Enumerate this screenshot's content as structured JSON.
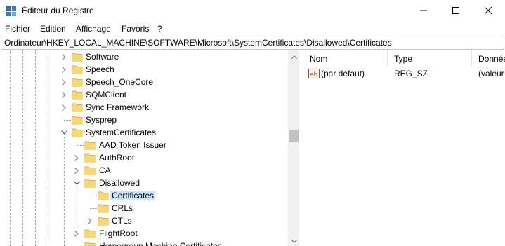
{
  "window": {
    "title": "Éditeur du Registre",
    "icon": "regedit-icon",
    "controls": [
      "minimize-icon",
      "maximize-icon",
      "close-icon"
    ]
  },
  "menu": {
    "items": [
      "Fichier",
      "Edition",
      "Affichage",
      "Favoris",
      "?"
    ]
  },
  "address": {
    "path": "Ordinateur\\HKEY_LOCAL_MACHINE\\SOFTWARE\\Microsoft\\SystemCertificates\\Disallowed\\Certificates"
  },
  "tree": {
    "items": [
      {
        "label": "Software",
        "level": 0,
        "chevron": "collapsed",
        "selected": false
      },
      {
        "label": "Speech",
        "level": 0,
        "chevron": "collapsed",
        "selected": false
      },
      {
        "label": "Speech_OneCore",
        "level": 0,
        "chevron": "collapsed",
        "selected": false
      },
      {
        "label": "SQMClient",
        "level": 0,
        "chevron": "collapsed",
        "selected": false
      },
      {
        "label": "Sync Framework",
        "level": 0,
        "chevron": "collapsed",
        "selected": false
      },
      {
        "label": "Sysprep",
        "level": 0,
        "chevron": "none",
        "selected": false
      },
      {
        "label": "SystemCertificates",
        "level": 0,
        "chevron": "expanded",
        "selected": false
      },
      {
        "label": "AAD Token Issuer",
        "level": 1,
        "chevron": "none",
        "selected": false
      },
      {
        "label": "AuthRoot",
        "level": 1,
        "chevron": "collapsed",
        "selected": false
      },
      {
        "label": "CA",
        "level": 1,
        "chevron": "collapsed",
        "selected": false
      },
      {
        "label": "Disallowed",
        "level": 1,
        "chevron": "expanded",
        "selected": false
      },
      {
        "label": "Certificates",
        "level": 2,
        "chevron": "none",
        "selected": true
      },
      {
        "label": "CRLs",
        "level": 2,
        "chevron": "none",
        "selected": false
      },
      {
        "label": "CTLs",
        "level": 2,
        "chevron": "collapsed",
        "selected": false
      },
      {
        "label": "FlightRoot",
        "level": 1,
        "chevron": "collapsed",
        "selected": false
      },
      {
        "label": "Homegroup Machine Certificates",
        "level": 1,
        "chevron": "none",
        "selected": false
      }
    ]
  },
  "values": {
    "columns": [
      "Nom",
      "Type",
      "Données"
    ],
    "rows": [
      {
        "icon": "string-value-icon",
        "name": "(par défaut)",
        "type": "REG_SZ",
        "data": "(valeur non définie)"
      }
    ]
  },
  "colors": {
    "selection": "#cce8ff",
    "folder": "#f8d775",
    "folder_dark": "#e2b33c"
  }
}
